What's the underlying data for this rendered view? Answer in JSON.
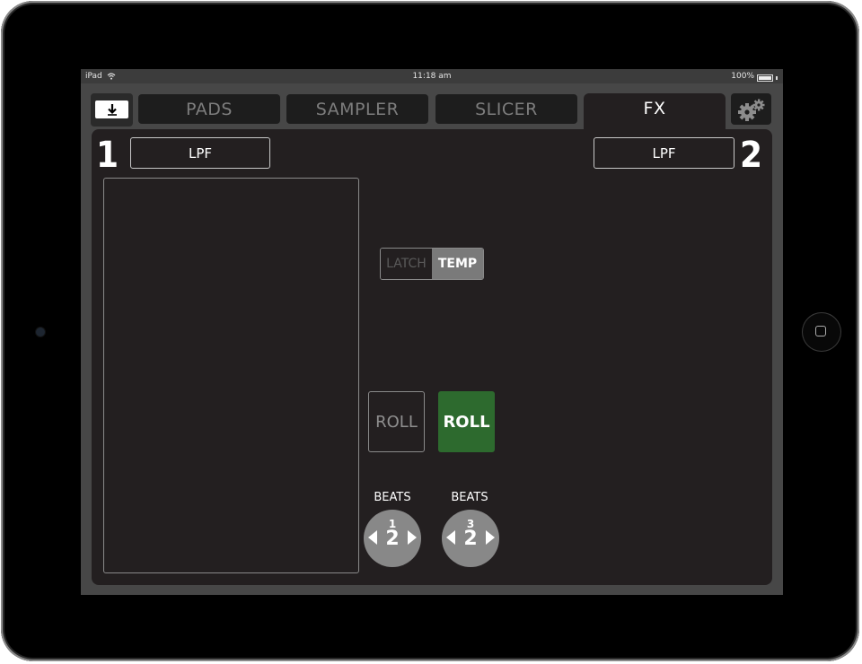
{
  "status_bar": {
    "device": "iPad",
    "time": "11:18 am",
    "battery": "100%"
  },
  "tabs": [
    {
      "label": "PADS",
      "active": false
    },
    {
      "label": "SAMPLER",
      "active": false
    },
    {
      "label": "SLICER",
      "active": false
    },
    {
      "label": "FX",
      "active": true
    }
  ],
  "icons": {
    "download": "download-icon",
    "settings": "gear-icon"
  },
  "fx": {
    "deck1": {
      "number": "1",
      "effect": "LPF"
    },
    "deck2": {
      "number": "2",
      "effect": "LPF"
    },
    "mode_toggle": {
      "latch_label": "LATCH",
      "temp_label": "TEMP",
      "selected": "TEMP"
    },
    "roll_left": {
      "label": "ROLL",
      "active": false
    },
    "roll_right": {
      "label": "ROLL",
      "active": true
    },
    "beats_left": {
      "label": "BEATS",
      "numerator": "1",
      "denominator": "2"
    },
    "beats_right": {
      "label": "BEATS",
      "numerator": "3",
      "denominator": "2"
    }
  },
  "colors": {
    "roll_active": "#2d6a2e",
    "panel": "#231f20",
    "frame": "#474747"
  }
}
